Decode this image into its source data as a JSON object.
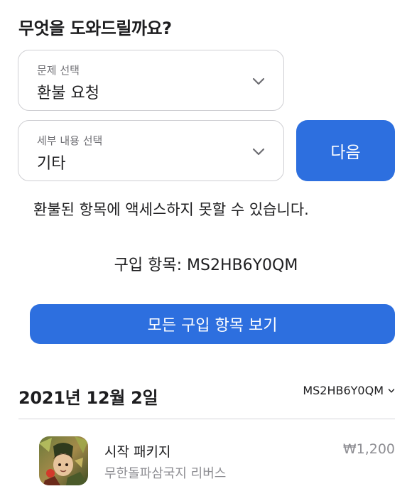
{
  "page": {
    "title": "무엇을 도와드릴까요?"
  },
  "issue_select": {
    "label": "문제 선택",
    "value": "환불 요청"
  },
  "detail_select": {
    "label": "세부 내용 선택",
    "value": "기타"
  },
  "next_button": {
    "label": "다음"
  },
  "message": {
    "error": "환불된 항목에 액세스하지 못할 수 있습니다."
  },
  "order": {
    "line": "구입 항목: MS2HB6Y0QM"
  },
  "view_all_button": {
    "label": "모든 구입 항목 보기"
  },
  "purchase": {
    "date": "2021년 12월 2일",
    "order_id": "MS2HB6Y0QM",
    "item_name": "시작 패키지",
    "app_name": "무한돌파삼국지 리버스",
    "price": "₩1,200"
  },
  "icons": {
    "chevron": "chevron-down-icon",
    "app": "app-icon"
  },
  "colors": {
    "accent": "#2d6fdf",
    "text": "#1d1d1f",
    "secondary_text": "#8e8e93",
    "border": "#cfcfd3"
  }
}
